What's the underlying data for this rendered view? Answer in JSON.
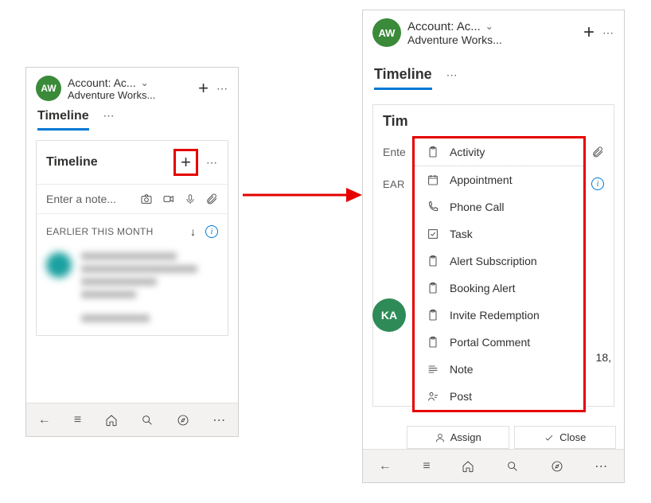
{
  "header": {
    "avatar": "AW",
    "title": "Account: Ac...",
    "subtitle": "Adventure Works..."
  },
  "tabs": {
    "active": "Timeline"
  },
  "card": {
    "title": "Timeline",
    "note_placeholder": "Enter a note...",
    "section_label": "EARLIER THIS MONTH"
  },
  "menu": {
    "items": [
      {
        "icon": "clipboard-icon",
        "label": "Activity"
      },
      {
        "icon": "calendar-icon",
        "label": "Appointment"
      },
      {
        "icon": "phone-icon",
        "label": "Phone Call"
      },
      {
        "icon": "task-icon",
        "label": "Task"
      },
      {
        "icon": "clipboard-icon",
        "label": "Alert Subscription"
      },
      {
        "icon": "clipboard-icon",
        "label": "Booking Alert"
      },
      {
        "icon": "clipboard-icon",
        "label": "Invite Redemption"
      },
      {
        "icon": "clipboard-icon",
        "label": "Portal Comment"
      },
      {
        "icon": "note-icon",
        "label": "Note"
      },
      {
        "icon": "post-icon",
        "label": "Post"
      }
    ]
  },
  "right_extras": {
    "avatar2": "KA",
    "date_fragment": "18,",
    "assign": "Assign",
    "close": "Close"
  },
  "truncated": {
    "tim": "Tim",
    "ente": "Ente",
    "ear": "EAR"
  }
}
